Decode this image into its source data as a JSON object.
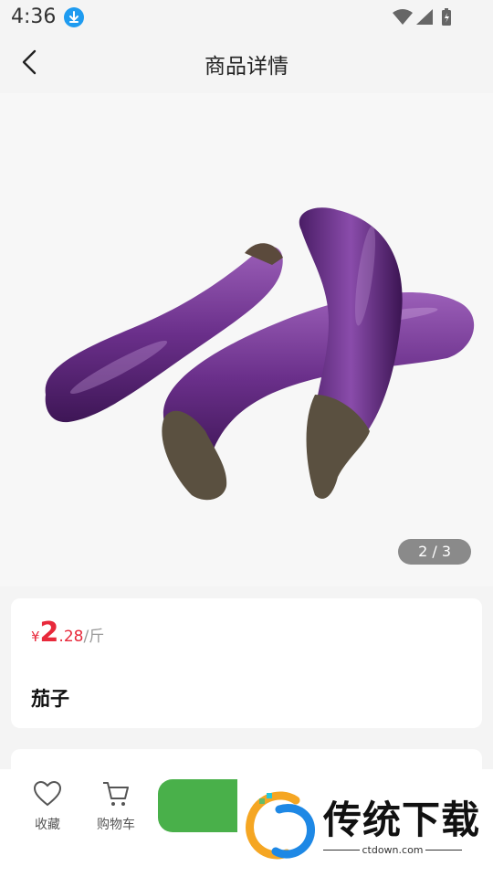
{
  "status_bar": {
    "time": "4:36"
  },
  "header": {
    "title": "商品详情",
    "back_icon": "chevron-left-icon"
  },
  "gallery": {
    "indicator": "2 / 3",
    "current_image": 2,
    "total_images": 3
  },
  "product": {
    "currency": "¥",
    "price_integer": "2",
    "price_decimal": ".28",
    "unit": "/斤",
    "name": "茄子"
  },
  "bottom_bar": {
    "favorite_label": "收藏",
    "cart_label": "购物车",
    "buy_button_color": "#49b04a"
  },
  "watermark": {
    "text": "传统下载",
    "url": "ctdown.com"
  },
  "colors": {
    "price": "#e8293b",
    "download_badge": "#1e9bf0"
  }
}
